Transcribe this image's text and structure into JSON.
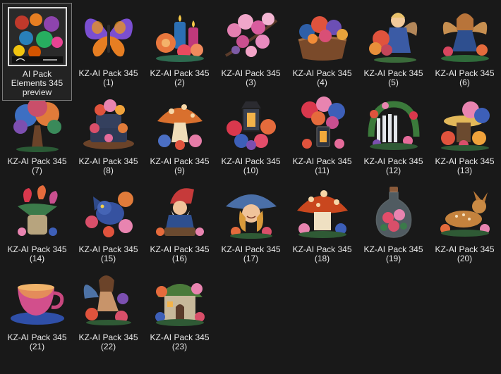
{
  "files": [
    {
      "line1": "AI Pack",
      "line2": "Elements 345",
      "line3": "preview",
      "icon": "pack-preview-thumbnail",
      "selected": true
    },
    {
      "line1": "KZ-AI Pack 345",
      "line2": "(1)",
      "icon": "butterfly-thumbnail"
    },
    {
      "line1": "KZ-AI Pack 345",
      "line2": "(2)",
      "icon": "candles-flowers-thumbnail"
    },
    {
      "line1": "KZ-AI Pack 345",
      "line2": "(3)",
      "icon": "blossom-branch-thumbnail"
    },
    {
      "line1": "KZ-AI Pack 345",
      "line2": "(4)",
      "icon": "flower-basket-thumbnail"
    },
    {
      "line1": "KZ-AI Pack 345",
      "line2": "(5)",
      "icon": "fairy-child-thumbnail"
    },
    {
      "line1": "KZ-AI Pack 345",
      "line2": "(6)",
      "icon": "fairy-girl-thumbnail"
    },
    {
      "line1": "KZ-AI Pack 345",
      "line2": "(7)",
      "icon": "tree-thumbnail"
    },
    {
      "line1": "KZ-AI Pack 345",
      "line2": "(8)",
      "icon": "flower-cake-thumbnail"
    },
    {
      "line1": "KZ-AI Pack 345",
      "line2": "(9)",
      "icon": "mushroom-thumbnail"
    },
    {
      "line1": "KZ-AI Pack 345",
      "line2": "(10)",
      "icon": "lantern-flowers-thumbnail"
    },
    {
      "line1": "KZ-AI Pack 345",
      "line2": "(11)",
      "icon": "lantern-bouquet-thumbnail"
    },
    {
      "line1": "KZ-AI Pack 345",
      "line2": "(12)",
      "icon": "garden-gate-thumbnail"
    },
    {
      "line1": "KZ-AI Pack 345",
      "line2": "(13)",
      "icon": "tree-stump-flowers-thumbnail"
    },
    {
      "line1": "KZ-AI Pack 345",
      "line2": "(14)",
      "icon": "tulip-jar-thumbnail"
    },
    {
      "line1": "KZ-AI Pack 345",
      "line2": "(15)",
      "icon": "dragon-thumbnail"
    },
    {
      "line1": "KZ-AI Pack 345",
      "line2": "(16)",
      "icon": "gnome-thumbnail"
    },
    {
      "line1": "KZ-AI Pack 345",
      "line2": "(17)",
      "icon": "mushroom-girl-thumbnail"
    },
    {
      "line1": "KZ-AI Pack 345",
      "line2": "(18)",
      "icon": "mushroom-house-thumbnail"
    },
    {
      "line1": "KZ-AI Pack 345",
      "line2": "(19)",
      "icon": "flower-bottle-thumbnail"
    },
    {
      "line1": "KZ-AI Pack 345",
      "line2": "(20)",
      "icon": "fawn-thumbnail"
    },
    {
      "line1": "KZ-AI Pack 345",
      "line2": "(21)",
      "icon": "teacup-thumbnail"
    },
    {
      "line1": "KZ-AI Pack 345",
      "line2": "(22)",
      "icon": "fairy-sitting-thumbnail"
    },
    {
      "line1": "KZ-AI Pack 345",
      "line2": "(23)",
      "icon": "fairy-house-thumbnail"
    }
  ],
  "colors": {
    "background": "#191919",
    "selection_border": "#7a7a7a",
    "text": "#e8e8e8"
  }
}
